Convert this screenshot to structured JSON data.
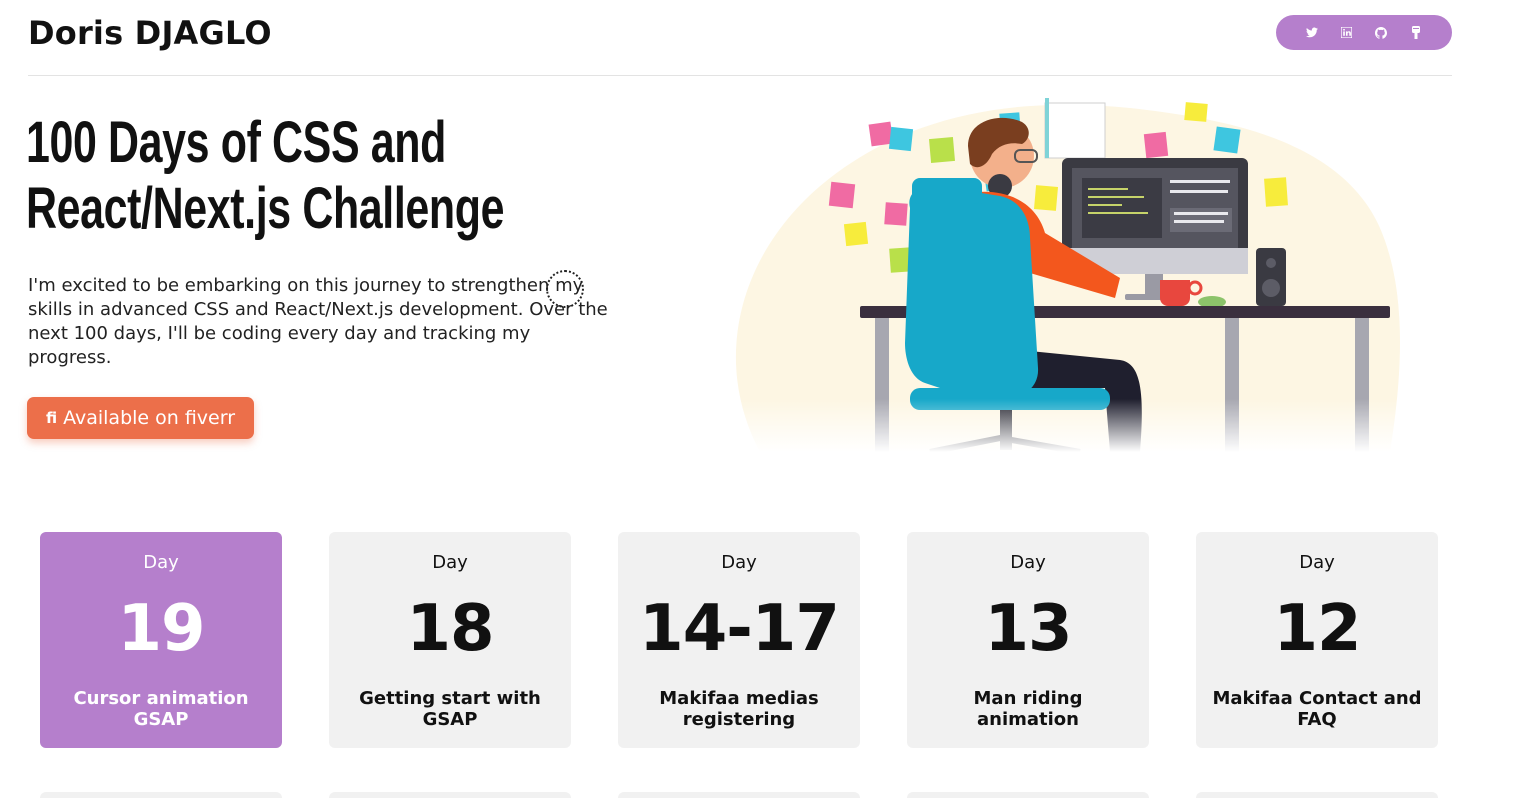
{
  "header": {
    "site_name": "Doris DJAGLO",
    "social": [
      "twitter-icon",
      "linkedin-icon",
      "github-icon",
      "dev-icon"
    ]
  },
  "hero": {
    "title_line1": "100 Days of CSS and",
    "title_line2": "React/Next.js Challenge",
    "description": "I'm excited to be embarking on this journey to strengthen my skills in advanced CSS and React/Next.js development. Over the next 100 days, I'll be coding every day and tracking my progress.",
    "cta_icon": "fi",
    "cta_label": "Available on fiverr"
  },
  "cards": [
    {
      "label": "Day",
      "number": "19",
      "title": "Cursor animation GSAP"
    },
    {
      "label": "Day",
      "number": "18",
      "title": "Getting start with GSAP"
    },
    {
      "label": "Day",
      "number": "14-17",
      "title": "Makifaa medias registering"
    },
    {
      "label": "Day",
      "number": "13",
      "title": "Man riding animation"
    },
    {
      "label": "Day",
      "number": "12",
      "title": "Makifaa Contact and FAQ"
    }
  ],
  "colors": {
    "accent": "#b57fcc",
    "cta": "#ec6f4a",
    "card_bg": "#f1f1f1"
  }
}
